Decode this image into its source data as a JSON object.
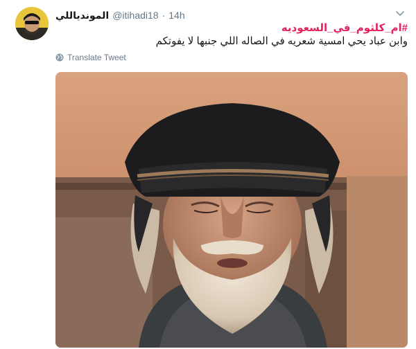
{
  "tweet": {
    "display_name": "الموندياللي",
    "handle": "@itihadi18",
    "separator": "·",
    "timestamp": "14h",
    "hashtag": "#ام_كلثوم_في_السعوديه",
    "body": "وابن عباد يحي امسية شعريه في الصاله اللي جنبها لا يفوتكم",
    "translate_label": "Translate Tweet",
    "colors": {
      "hashtag": "#e0245e",
      "muted": "#657786",
      "text": "#14171a"
    },
    "icons": {
      "caret": "chevron-down-icon",
      "translate": "globe-icon"
    }
  }
}
